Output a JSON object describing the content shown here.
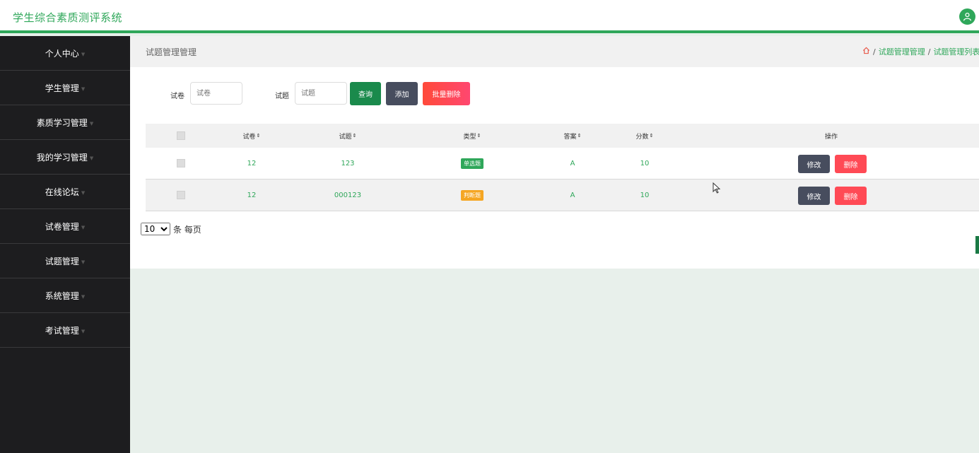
{
  "header": {
    "title": "学生综合素质测评系统"
  },
  "sidebar": {
    "items": [
      {
        "label": "个人中心"
      },
      {
        "label": "学生管理"
      },
      {
        "label": "素质学习管理"
      },
      {
        "label": "我的学习管理"
      },
      {
        "label": "在线论坛"
      },
      {
        "label": "试卷管理"
      },
      {
        "label": "试题管理"
      },
      {
        "label": "系统管理"
      },
      {
        "label": "考试管理"
      }
    ]
  },
  "breadcrumb": {
    "page_title": "试题管理管理",
    "sep": "/",
    "items": [
      "试题管理管理",
      "试题管理列表"
    ]
  },
  "search": {
    "paper_label": "试卷",
    "paper_placeholder": "试卷",
    "question_label": "试题",
    "question_placeholder": "试题",
    "query_label": "查询",
    "add_label": "添加",
    "batch_delete_label": "批量删除"
  },
  "table": {
    "headers": [
      "试卷",
      "试题",
      "类型",
      "答案",
      "分数",
      "操作"
    ],
    "sort_glyph": "⇕",
    "rows": [
      {
        "paper": "12",
        "question": "123",
        "type": "单选题",
        "type_color": "#2fa75a",
        "answer": "A",
        "score": "10",
        "edit": "修改",
        "delete": "删除"
      },
      {
        "paper": "12",
        "question": "000123",
        "type": "判断题",
        "type_color": "#f5a623",
        "answer": "A",
        "score": "10",
        "edit": "修改",
        "delete": "删除"
      }
    ]
  },
  "pagination": {
    "page_size": "10",
    "suffix": "条 每页"
  },
  "colors": {
    "accent": "#2fa75a",
    "sidebar_bg": "#1d1d1f",
    "btn_dark": "#474d5e",
    "btn_red": "#ff4a55"
  }
}
